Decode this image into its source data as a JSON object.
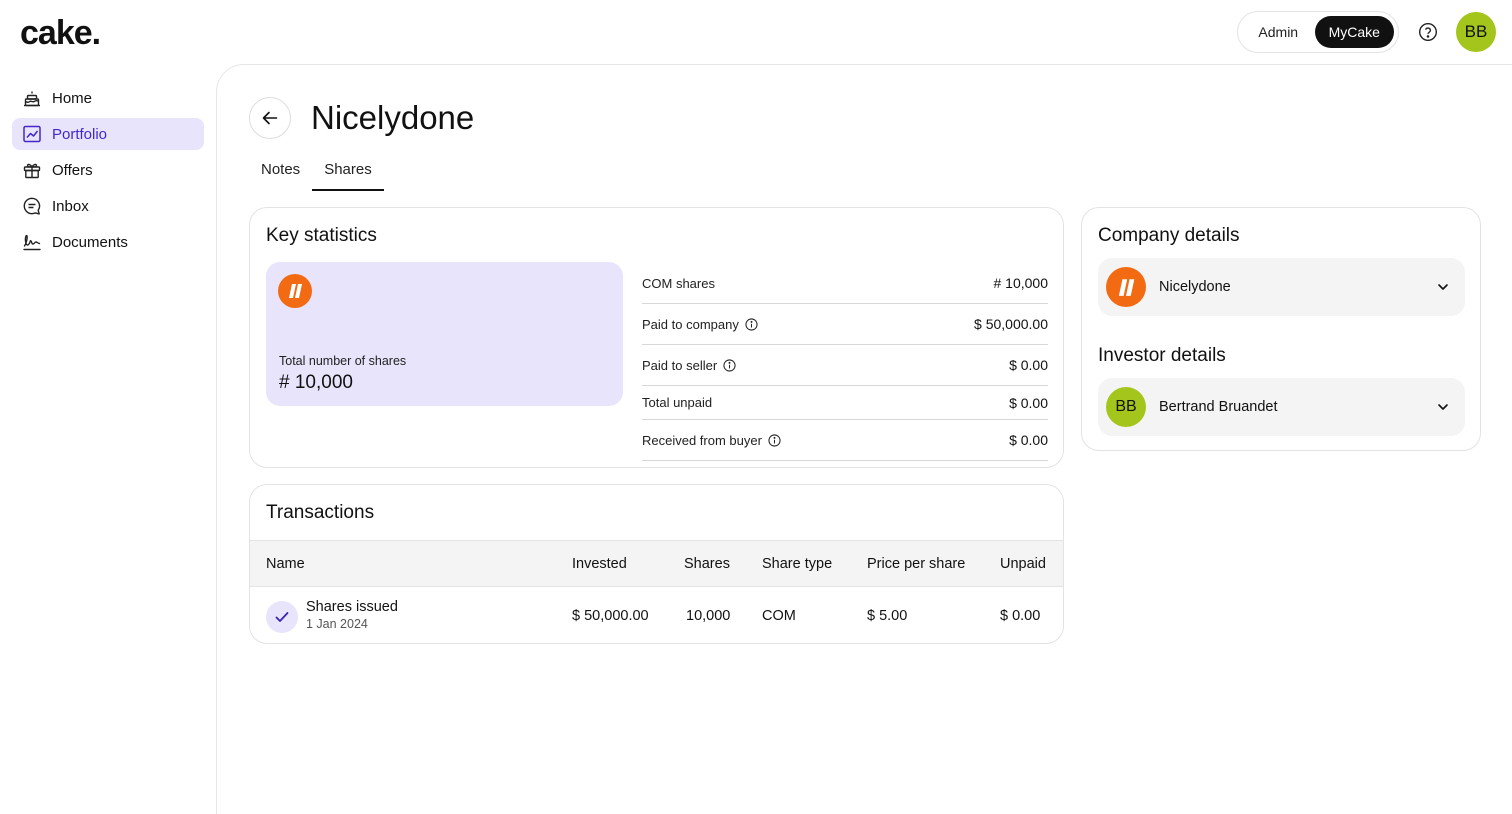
{
  "app": {
    "logo": "cake."
  },
  "topbar": {
    "mode_options": [
      "Admin",
      "MyCake"
    ],
    "active_mode": "MyCake",
    "help_icon": "help-circle-icon",
    "user_initials": "BB",
    "avatar_color": "#a4c51b"
  },
  "sidebar": {
    "items": [
      {
        "label": "Home",
        "icon": "cake-home-icon",
        "active": false
      },
      {
        "label": "Portfolio",
        "icon": "chart-icon",
        "active": true
      },
      {
        "label": "Offers",
        "icon": "gift-icon",
        "active": false
      },
      {
        "label": "Inbox",
        "icon": "message-icon",
        "active": false
      },
      {
        "label": "Documents",
        "icon": "signature-icon",
        "active": false
      }
    ],
    "active_color": "#4527c9",
    "active_bg": "#e8e4fb"
  },
  "page": {
    "title": "Nicelydone",
    "tabs": [
      "Notes",
      "Shares"
    ],
    "active_tab": "Shares"
  },
  "key_statistics": {
    "title": "Key statistics",
    "total_label": "Total number of shares",
    "total_value": "# 10,000",
    "rows": [
      {
        "label": "COM shares",
        "value": "# 10,000",
        "info": false
      },
      {
        "label": "Paid to company",
        "value": "$ 50,000.00",
        "info": true
      },
      {
        "label": "Paid to seller",
        "value": "$ 0.00",
        "info": true
      },
      {
        "label": "Total unpaid",
        "value": "$ 0.00",
        "info": false
      },
      {
        "label": "Received from buyer",
        "value": "$ 0.00",
        "info": true
      }
    ]
  },
  "transactions": {
    "title": "Transactions",
    "columns": [
      "Name",
      "Invested",
      "Shares",
      "Share type",
      "Price per share",
      "Unpaid"
    ],
    "rows": [
      {
        "name": "Shares issued",
        "date": "1 Jan 2024",
        "invested": "$ 50,000.00",
        "shares": "10,000",
        "share_type": "COM",
        "price_per_share": "$ 5.00",
        "unpaid": "$ 0.00"
      }
    ]
  },
  "company_details": {
    "title": "Company details",
    "name": "Nicelydone",
    "logo_color": "#f26a12"
  },
  "investor_details": {
    "title": "Investor details",
    "initials": "BB",
    "name": "Bertrand Bruandet"
  }
}
